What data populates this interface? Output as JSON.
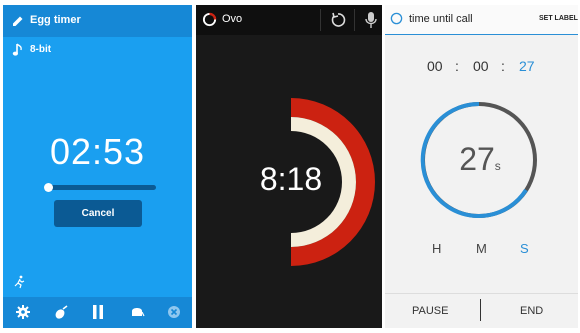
{
  "egg_timer": {
    "title": "Egg timer",
    "sound_name": "8-bit",
    "time": "02:53",
    "progress": 0.04,
    "cancel_label": "Cancel",
    "colors": {
      "background": "#1a9ff0",
      "bar": "#1688d6",
      "button": "#0b5a94"
    }
  },
  "ovo": {
    "title": "Ovo",
    "time": "8:18",
    "colors": {
      "background": "#191919",
      "ring_red": "#cc2211",
      "ring_cream": "#f4eedb"
    }
  },
  "call_timer": {
    "title": "time until call",
    "set_label": "SET LABEL",
    "hours": "00",
    "minutes": "00",
    "seconds": "27",
    "big_value": "27",
    "big_unit": "s",
    "h_label": "H",
    "m_label": "M",
    "s_label": "S",
    "pause_label": "PAUSE",
    "end_label": "END",
    "colors": {
      "accent": "#2a8fd6",
      "remaining": "#555555"
    }
  }
}
